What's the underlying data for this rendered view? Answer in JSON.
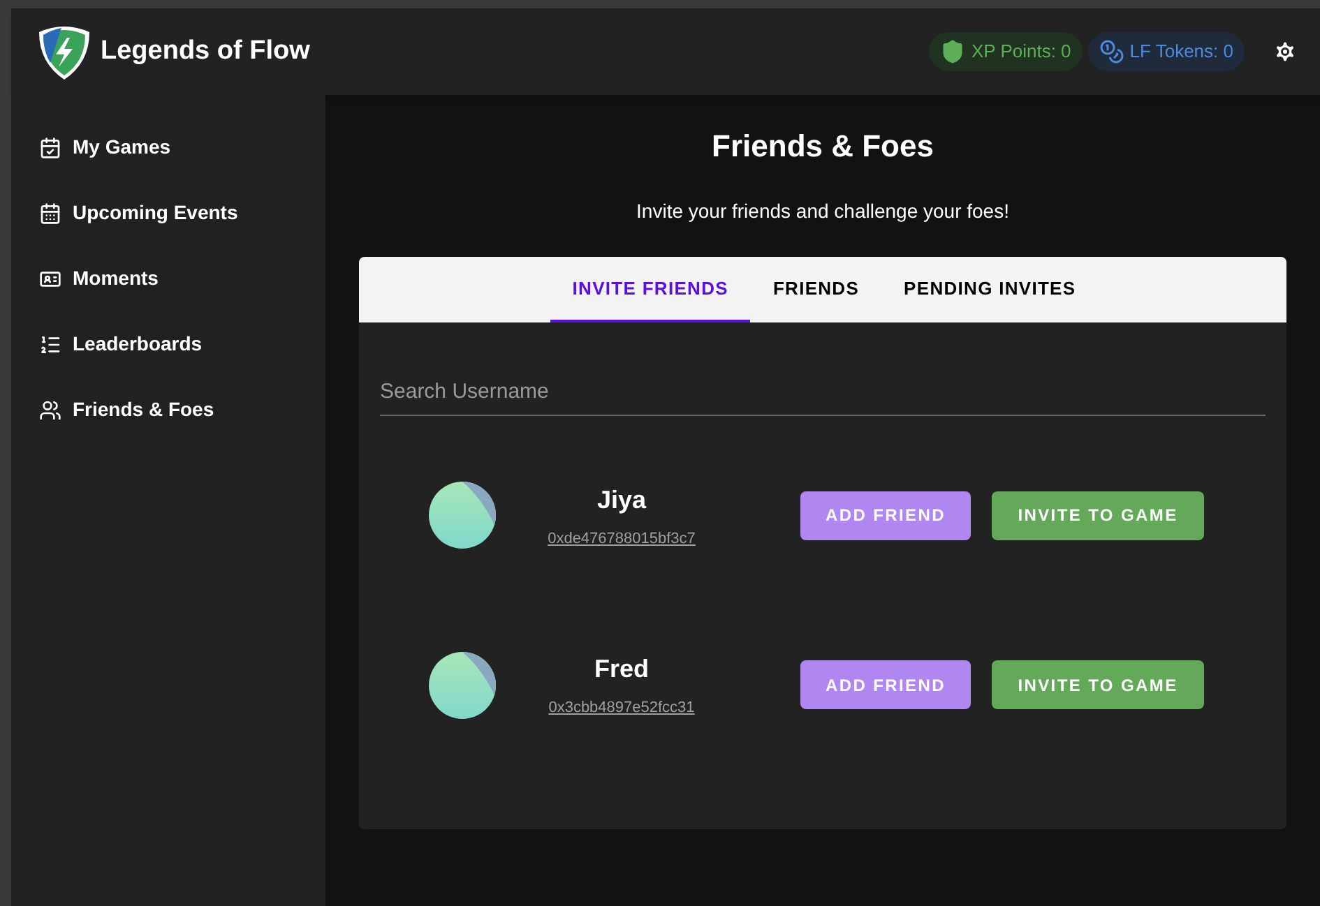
{
  "header": {
    "brand": "Legends of Flow",
    "xp": "XP Points: 0",
    "tokens": "LF Tokens: 0"
  },
  "sidebar": {
    "items": [
      {
        "label": "My Games",
        "kind": "games"
      },
      {
        "label": "Upcoming Events",
        "kind": "events"
      },
      {
        "label": "Moments",
        "kind": "moments"
      },
      {
        "label": "Leaderboards",
        "kind": "leaderboards"
      },
      {
        "label": "Friends & Foes",
        "kind": "friends"
      }
    ]
  },
  "page": {
    "title": "Friends & Foes",
    "subtitle": "Invite your friends and challenge your foes!"
  },
  "tabs": [
    {
      "label": "INVITE FRIENDS",
      "selected": true
    },
    {
      "label": "FRIENDS",
      "selected": false
    },
    {
      "label": "PENDING INVITES",
      "selected": false
    }
  ],
  "search": {
    "placeholder": "Search Username"
  },
  "users": [
    {
      "name": "Jiya",
      "address": "0xde476788015bf3c7",
      "add": "ADD FRIEND",
      "invite": "INVITE TO GAME"
    },
    {
      "name": "Fred",
      "address": "0x3cbb4897e52fcc31",
      "add": "ADD FRIEND",
      "invite": "INVITE TO GAME"
    }
  ]
}
